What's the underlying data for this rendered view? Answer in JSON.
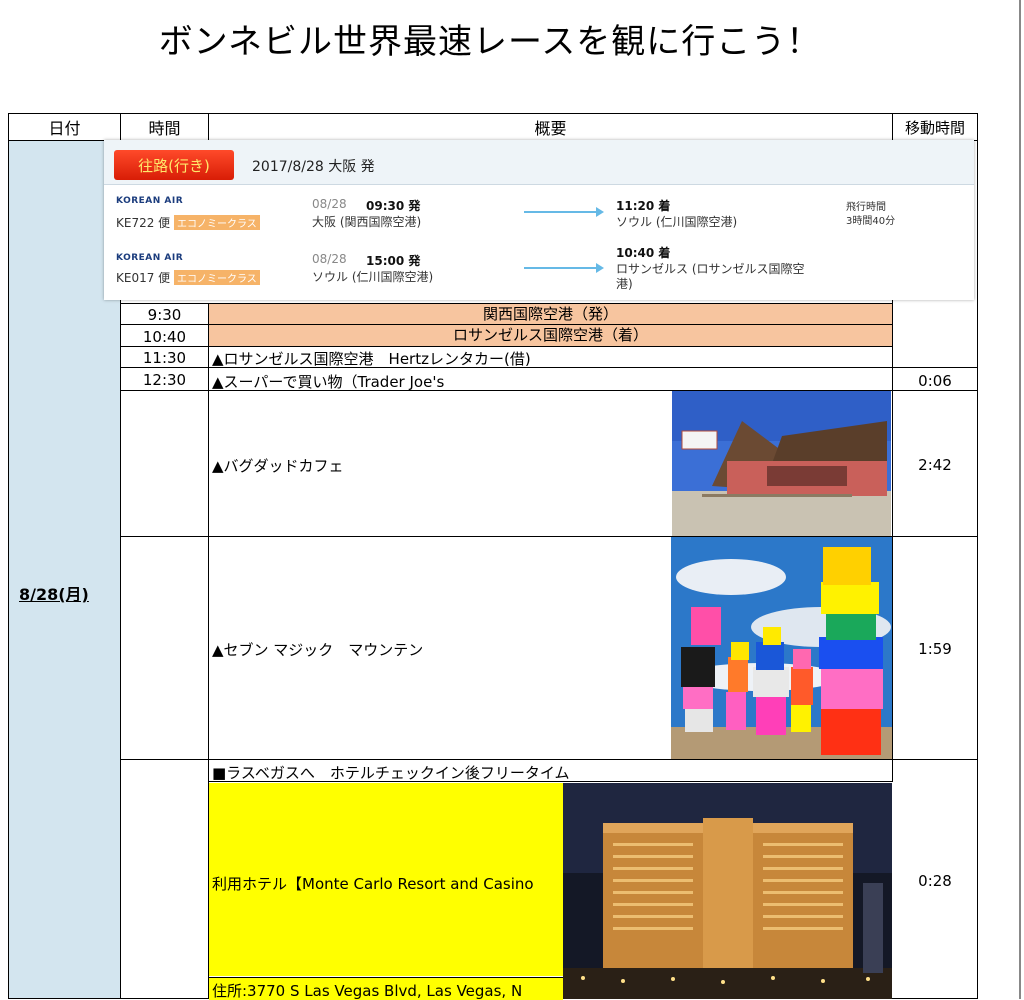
{
  "title": "ボンネビル世界最速レースを観に行こう！",
  "headers": {
    "date": "日付",
    "time": "時間",
    "summary": "概要",
    "move": "移動時間"
  },
  "date": "8/28(月)",
  "flight_panel": {
    "badge": "往路(行き)",
    "title": "2017/8/28 大阪 発",
    "flights": [
      {
        "airline": "KOREAN AIR",
        "flight_no": "KE722 便",
        "class": "エコノミークラス",
        "dep_date": "08/28",
        "dep_time": "09:30 発",
        "dep_airport": "大阪 (関西国際空港)",
        "arr_time": "11:20 着",
        "arr_airport": "ソウル (仁川国際空港)",
        "duration_label": "飛行時間",
        "duration": "3時間40分"
      },
      {
        "airline": "KOREAN AIR",
        "flight_no": "KE017 便",
        "class": "エコノミークラス",
        "dep_date": "08/28",
        "dep_time": "15:00 発",
        "dep_airport": "ソウル (仁川国際空港)",
        "arr_time": "10:40 着",
        "arr_airport_line1": "ロサンゼルス (ロサンゼルス国際空",
        "arr_airport_line2": "港)"
      }
    ]
  },
  "rows": [
    {
      "time": "9:30",
      "text": "関西国際空港（発）",
      "move": ""
    },
    {
      "time": "10:40",
      "text": "ロサンゼルス国際空港（着）",
      "move": ""
    },
    {
      "time": "11:30",
      "text": "▲ロサンゼルス国際空港　Hertzレンタカー(借)",
      "move": ""
    },
    {
      "time": "12:30",
      "text": "▲スーパーで買い物（Trader Joe's",
      "move": "0:06"
    },
    {
      "time": "",
      "text": "▲バグダッドカフェ",
      "move": "2:42"
    },
    {
      "time": "",
      "text": "▲セブン マジック　マウンテン",
      "move": "1:59"
    },
    {
      "time": "",
      "text": "■ラスベガスへ　ホテルチェックイン後フリータイム",
      "move": "0:28"
    }
  ],
  "hotel": {
    "name": "利用ホテル【Monte Carlo Resort and Casino",
    "address": "住所:3770 S Las Vegas Blvd, Las Vegas, N"
  },
  "colors": {
    "date_col": "#d3e5ef",
    "orange": "#f7c59f",
    "yellow": "#ffff00",
    "badge": "#e02a0c"
  }
}
